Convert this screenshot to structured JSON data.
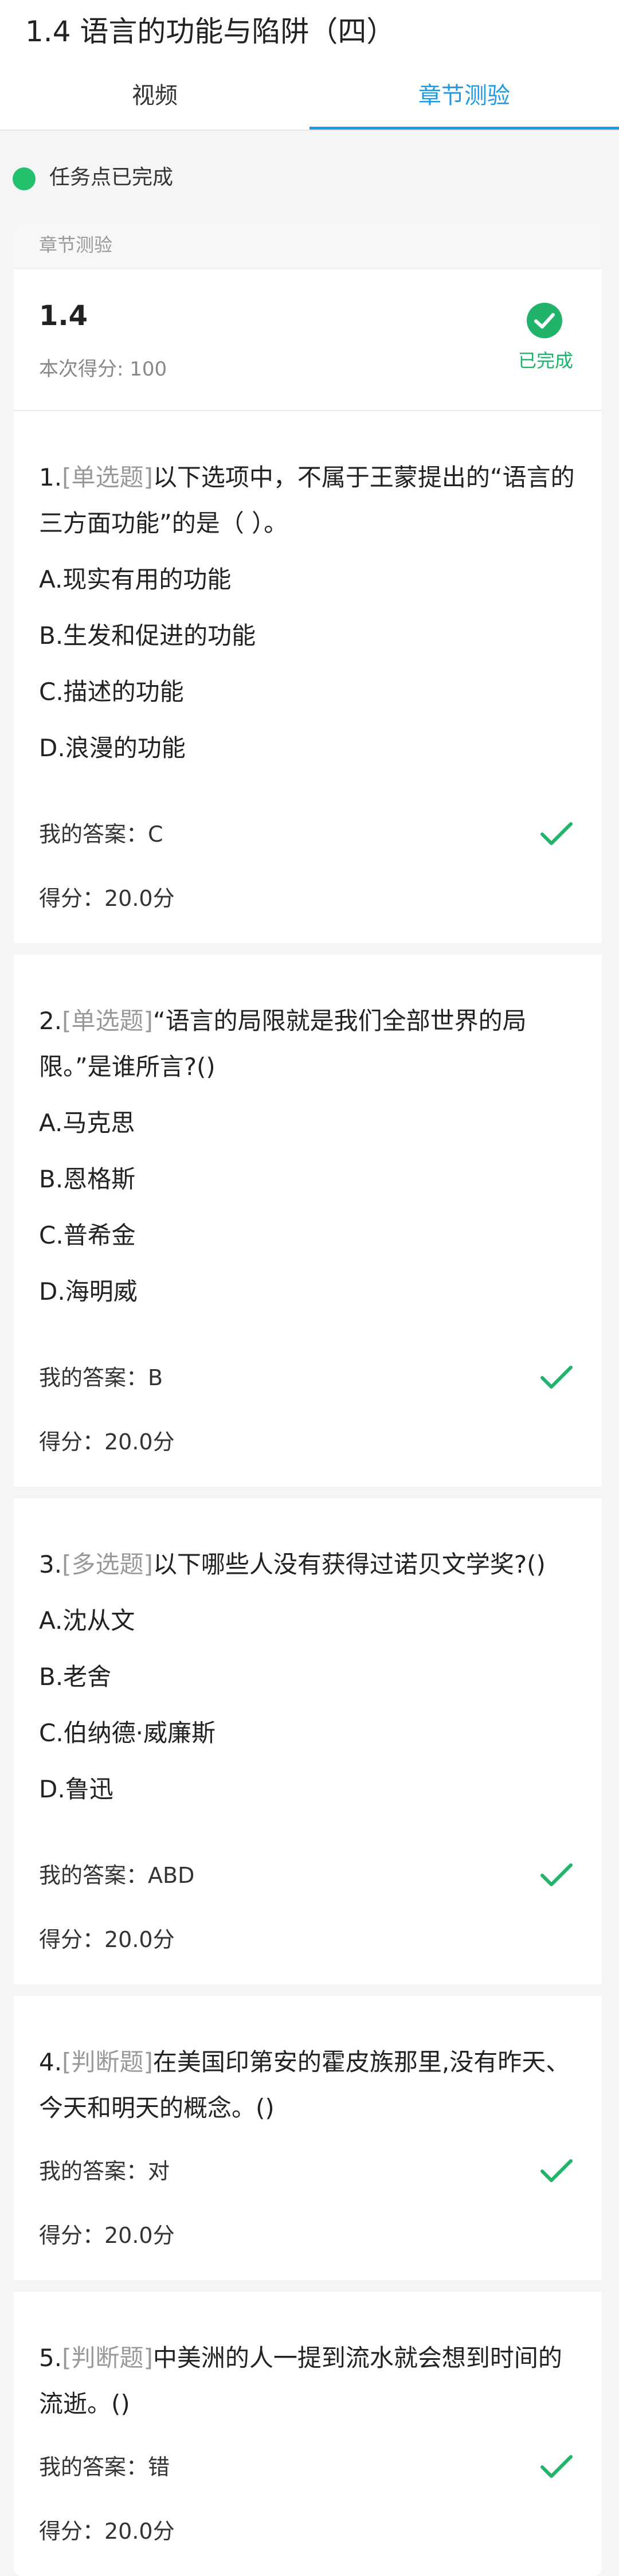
{
  "header": {
    "title": "1.4  语言的功能与陷阱（四）",
    "tabs": [
      {
        "label": "视频"
      },
      {
        "label": "章节测验"
      }
    ]
  },
  "status": {
    "text": "任务点已完成",
    "color": "#23c16b"
  },
  "card": {
    "title": "章节测验",
    "summary": {
      "number": "1.4",
      "score": "本次得分: 100",
      "done_label": "已完成"
    }
  },
  "questions": [
    {
      "num": "1.",
      "type": "[单选题]",
      "text": "以下选项中，不属于王蒙提出的“语言的三方面功能”的是（ ）。",
      "options": [
        "A.现实有用的功能",
        "B.生发和促进的功能",
        "C.描述的功能",
        "D.浪漫的功能"
      ],
      "answer": "我的答案：C",
      "score": "得分：20.0分"
    },
    {
      "num": "2.",
      "type": "[单选题]",
      "text": "“语言的局限就是我们全部世界的局限。”是谁所言?()",
      "options": [
        "A.马克思",
        "B.恩格斯",
        "C.普希金",
        "D.海明威"
      ],
      "answer": "我的答案：B",
      "score": "得分：20.0分"
    },
    {
      "num": "3.",
      "type": "[多选题]",
      "text": "以下哪些人没有获得过诺贝文学奖?()",
      "options": [
        "A.沈从文",
        "B.老舍",
        "C.伯纳德·威廉斯",
        "D.鲁迅"
      ],
      "answer": "我的答案：ABD",
      "score": "得分：20.0分"
    },
    {
      "num": "4.",
      "type": "[判断题]",
      "text": "在美国印第安的霍皮族那里,没有昨天、今天和明天的概念。()",
      "options": [],
      "answer": "我的答案：对",
      "score": "得分：20.0分"
    },
    {
      "num": "5.",
      "type": "[判断题]",
      "text": "中美洲的人一提到流水就会想到时间的流逝。()",
      "options": [],
      "answer": "我的答案：错",
      "score": "得分：20.0分"
    }
  ],
  "icons": {
    "correct": "check-icon",
    "completed": "check-circle-icon"
  },
  "colors": {
    "accent": "#1e9be6",
    "success": "#22b36a"
  }
}
